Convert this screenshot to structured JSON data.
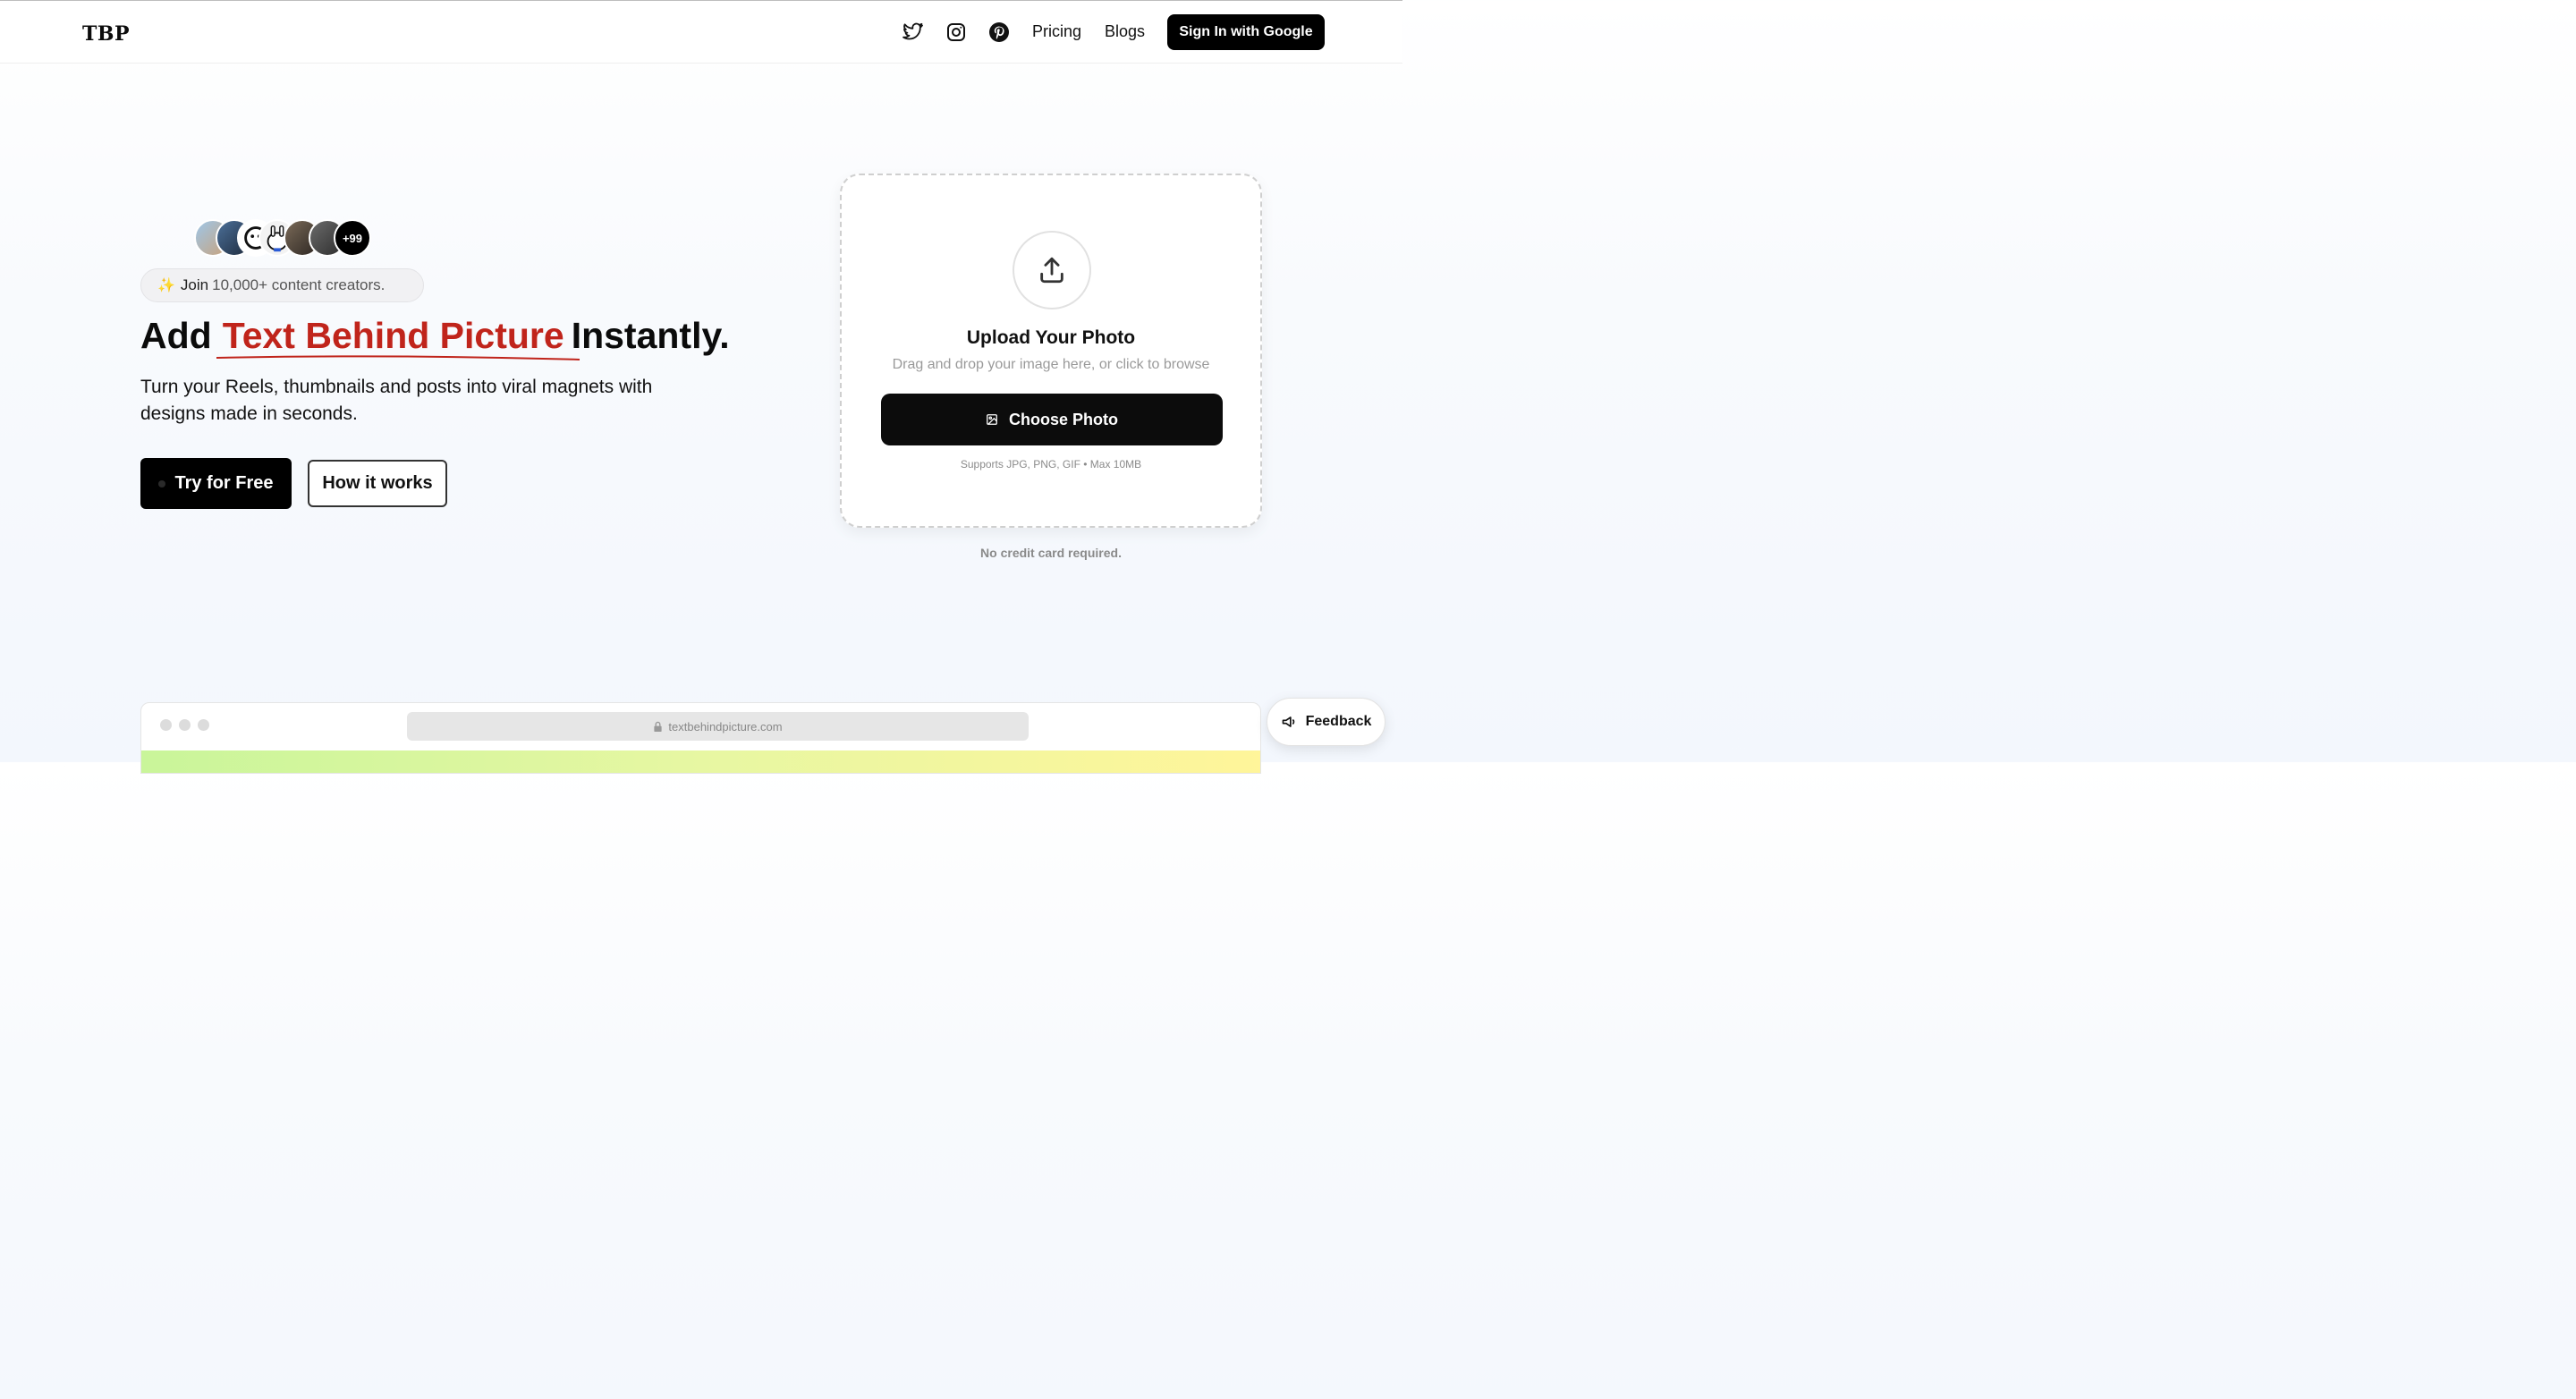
{
  "header": {
    "logo": "TBP",
    "nav": {
      "pricing": "Pricing",
      "blogs": "Blogs"
    },
    "signin_label": "Sign In with Google",
    "social_icons": [
      "twitter-icon",
      "instagram-icon",
      "pinterest-icon"
    ]
  },
  "hero": {
    "avatar_more": "+99",
    "join_prefix": "Join",
    "join_text": "10,000+ content creators.",
    "headline_start": "Add",
    "headline_highlight": "Text Behind Picture",
    "headline_end": "Instantly.",
    "subtitle": "Turn your Reels, thumbnails and posts into viral magnets with designs made in seconds.",
    "try_label": "Try for Free",
    "how_label": "How it works",
    "accent_color": "#c0241b"
  },
  "upload": {
    "title": "Upload Your Photo",
    "description": "Drag and drop your image here, or click to browse",
    "choose_label": "Choose Photo",
    "supports": "Supports JPG, PNG, GIF • Max 10MB",
    "no_credit": "No credit card required."
  },
  "preview": {
    "url": "textbehindpicture.com"
  },
  "feedback_label": "Feedback"
}
